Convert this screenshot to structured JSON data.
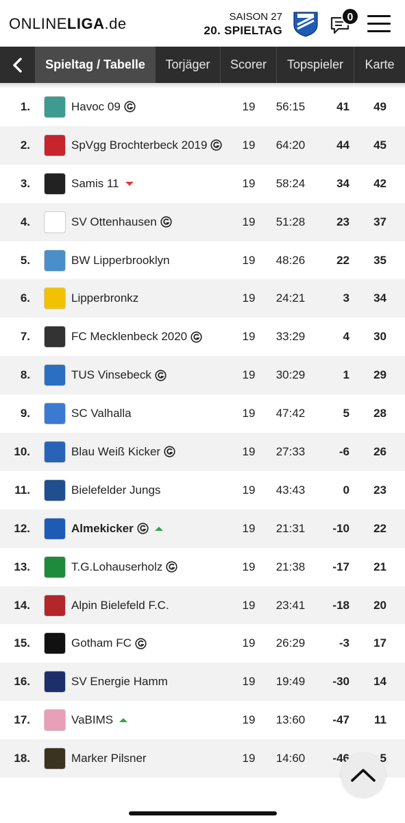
{
  "header": {
    "logo_part1": "ONLINE",
    "logo_part2": "LIGA",
    "logo_part3": ".de",
    "season_label": "SAISON 27",
    "matchday_label": "20. SPIELTAG",
    "notification_count": "0",
    "club_badge_text": "ALME KICKER"
  },
  "nav": {
    "tabs": [
      {
        "label": "Spieltag / Tabelle",
        "active": true
      },
      {
        "label": "Torjäger",
        "active": false
      },
      {
        "label": "Scorer",
        "active": false
      },
      {
        "label": "Topspieler",
        "active": false
      },
      {
        "label": "Karte",
        "active": false
      }
    ]
  },
  "colors": {
    "nav_bg": "#2d2d2d",
    "nav_active": "#4a4a4a",
    "row_alt": "#f2f2f2",
    "trend_up": "#2aa84a",
    "trend_down": "#e03a3a"
  },
  "table": {
    "rows": [
      {
        "rank": "1.",
        "team": "Havoc 09",
        "g": true,
        "trend": "",
        "games": "19",
        "goals": "56:15",
        "diff": "41",
        "points": "49",
        "bold": false,
        "logo_color": "#3d9c8f"
      },
      {
        "rank": "2.",
        "team": "SpVgg Brochterbeck 2019",
        "g": true,
        "trend": "",
        "games": "19",
        "goals": "64:20",
        "diff": "44",
        "points": "45",
        "bold": false,
        "logo_color": "#c8242c"
      },
      {
        "rank": "3.",
        "team": "Samis 11",
        "g": false,
        "trend": "down",
        "games": "19",
        "goals": "58:24",
        "diff": "34",
        "points": "42",
        "bold": false,
        "logo_color": "#222222"
      },
      {
        "rank": "4.",
        "team": "SV Ottenhausen",
        "g": true,
        "trend": "",
        "games": "19",
        "goals": "51:28",
        "diff": "23",
        "points": "37",
        "bold": false,
        "logo_color": "#ffffff"
      },
      {
        "rank": "5.",
        "team": "BW Lipperbrooklyn",
        "g": false,
        "trend": "",
        "games": "19",
        "goals": "48:26",
        "diff": "22",
        "points": "35",
        "bold": false,
        "logo_color": "#4a8fc9"
      },
      {
        "rank": "6.",
        "team": "Lipperbronkz",
        "g": false,
        "trend": "",
        "games": "19",
        "goals": "24:21",
        "diff": "3",
        "points": "34",
        "bold": false,
        "logo_color": "#f2c200"
      },
      {
        "rank": "7.",
        "team": "FC Mecklenbeck 2020",
        "g": true,
        "trend": "",
        "games": "19",
        "goals": "33:29",
        "diff": "4",
        "points": "30",
        "bold": false,
        "logo_color": "#333333"
      },
      {
        "rank": "8.",
        "team": "TUS Vinsebeck",
        "g": true,
        "trend": "",
        "games": "19",
        "goals": "30:29",
        "diff": "1",
        "points": "29",
        "bold": false,
        "logo_color": "#2a6fc1"
      },
      {
        "rank": "9.",
        "team": "SC Valhalla",
        "g": false,
        "trend": "",
        "games": "19",
        "goals": "47:42",
        "diff": "5",
        "points": "28",
        "bold": false,
        "logo_color": "#3b7ad1"
      },
      {
        "rank": "10.",
        "team": "Blau Weiß Kicker",
        "g": true,
        "trend": "",
        "games": "19",
        "goals": "27:33",
        "diff": "-6",
        "points": "26",
        "bold": false,
        "logo_color": "#2a62b8"
      },
      {
        "rank": "11.",
        "team": "Bielefelder Jungs",
        "g": false,
        "trend": "",
        "games": "19",
        "goals": "43:43",
        "diff": "0",
        "points": "23",
        "bold": false,
        "logo_color": "#1f4f8f"
      },
      {
        "rank": "12.",
        "team": "Almekicker",
        "g": true,
        "trend": "up",
        "games": "19",
        "goals": "21:31",
        "diff": "-10",
        "points": "22",
        "bold": true,
        "logo_color": "#1e5bb5"
      },
      {
        "rank": "13.",
        "team": "T.G.Lohauserholz",
        "g": true,
        "trend": "",
        "games": "19",
        "goals": "21:38",
        "diff": "-17",
        "points": "21",
        "bold": false,
        "logo_color": "#1e8a3c"
      },
      {
        "rank": "14.",
        "team": "Alpin Bielefeld F.C.",
        "g": false,
        "trend": "",
        "games": "19",
        "goals": "23:41",
        "diff": "-18",
        "points": "20",
        "bold": false,
        "logo_color": "#b3262a"
      },
      {
        "rank": "15.",
        "team": "Gotham FC",
        "g": true,
        "trend": "",
        "games": "19",
        "goals": "26:29",
        "diff": "-3",
        "points": "17",
        "bold": false,
        "logo_color": "#111111"
      },
      {
        "rank": "16.",
        "team": "SV Energie Hamm",
        "g": false,
        "trend": "",
        "games": "19",
        "goals": "19:49",
        "diff": "-30",
        "points": "14",
        "bold": false,
        "logo_color": "#1d2f6b"
      },
      {
        "rank": "17.",
        "team": "VaBIMS",
        "g": false,
        "trend": "up",
        "games": "19",
        "goals": "13:60",
        "diff": "-47",
        "points": "11",
        "bold": false,
        "logo_color": "#e8a0b8"
      },
      {
        "rank": "18.",
        "team": "Marker Pilsner",
        "g": false,
        "trend": "",
        "games": "19",
        "goals": "14:60",
        "diff": "-46",
        "points": "5",
        "bold": false,
        "logo_color": "#3a3320"
      }
    ]
  }
}
